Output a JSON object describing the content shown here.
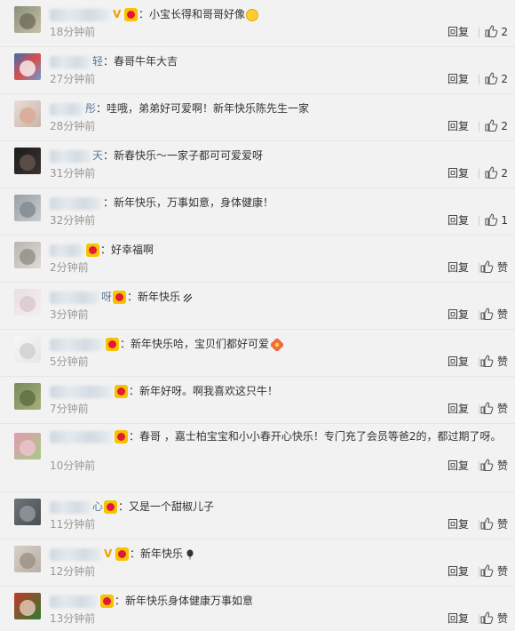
{
  "ui": {
    "reply_label": "回复",
    "like_label_zero": "赞"
  },
  "comments": [
    {
      "name_end": "",
      "text": "：小宝长得和哥哥好像",
      "time": "18分钟前",
      "likes": "2",
      "vip": true
    },
    {
      "name_end": "轻",
      "text": "：春哥牛年大吉",
      "time": "27分钟前",
      "likes": "2",
      "vip": false
    },
    {
      "name_end": "彤",
      "text": "：哇哦，弟弟好可爱啊！新年快乐陈先生一家",
      "time": "28分钟前",
      "likes": "2",
      "vip": false
    },
    {
      "name_end": "天",
      "text": "：新春快乐～一家子都可可爱爱呀",
      "time": "31分钟前",
      "likes": "2",
      "vip": false
    },
    {
      "name_end": "",
      "text": "：新年快乐，万事如意，身体健康！",
      "time": "32分钟前",
      "likes": "1",
      "vip": false
    },
    {
      "name_end": "",
      "text": "：好幸福啊",
      "time": "2分钟前",
      "likes": "赞",
      "vip": false
    },
    {
      "name_end": "呀",
      "text": "：新年快乐",
      "time": "3分钟前",
      "likes": "赞",
      "vip": false
    },
    {
      "name_end": "",
      "text": "：新年快乐哈，宝贝们都好可爱",
      "time": "5分钟前",
      "likes": "赞",
      "vip": false
    },
    {
      "name_end": "",
      "text": "：新年好呀。啊我喜欢这只牛！",
      "time": "7分钟前",
      "likes": "赞",
      "vip": false
    },
    {
      "name_end": "",
      "text": "：春哥 ，嘉士柏宝宝和小小春开心快乐！专门充了会员等爸2的，都过期了呀。",
      "time": "10分钟前",
      "likes": "赞",
      "vip": false
    },
    {
      "name_end": "心",
      "text": "：又是一个甜椒儿子",
      "time": "11分钟前",
      "likes": "赞",
      "vip": false
    },
    {
      "name_end": "",
      "text": "：新年快乐",
      "time": "12分钟前",
      "likes": "赞",
      "vip": true
    },
    {
      "name_end": "",
      "text": "：新年快乐身体健康万事如意",
      "time": "13分钟前",
      "likes": "赞",
      "vip": false
    }
  ],
  "colors": {
    "background": "#f2f2f2",
    "name": "#5d7a99",
    "time": "#999999",
    "text": "#333333"
  }
}
